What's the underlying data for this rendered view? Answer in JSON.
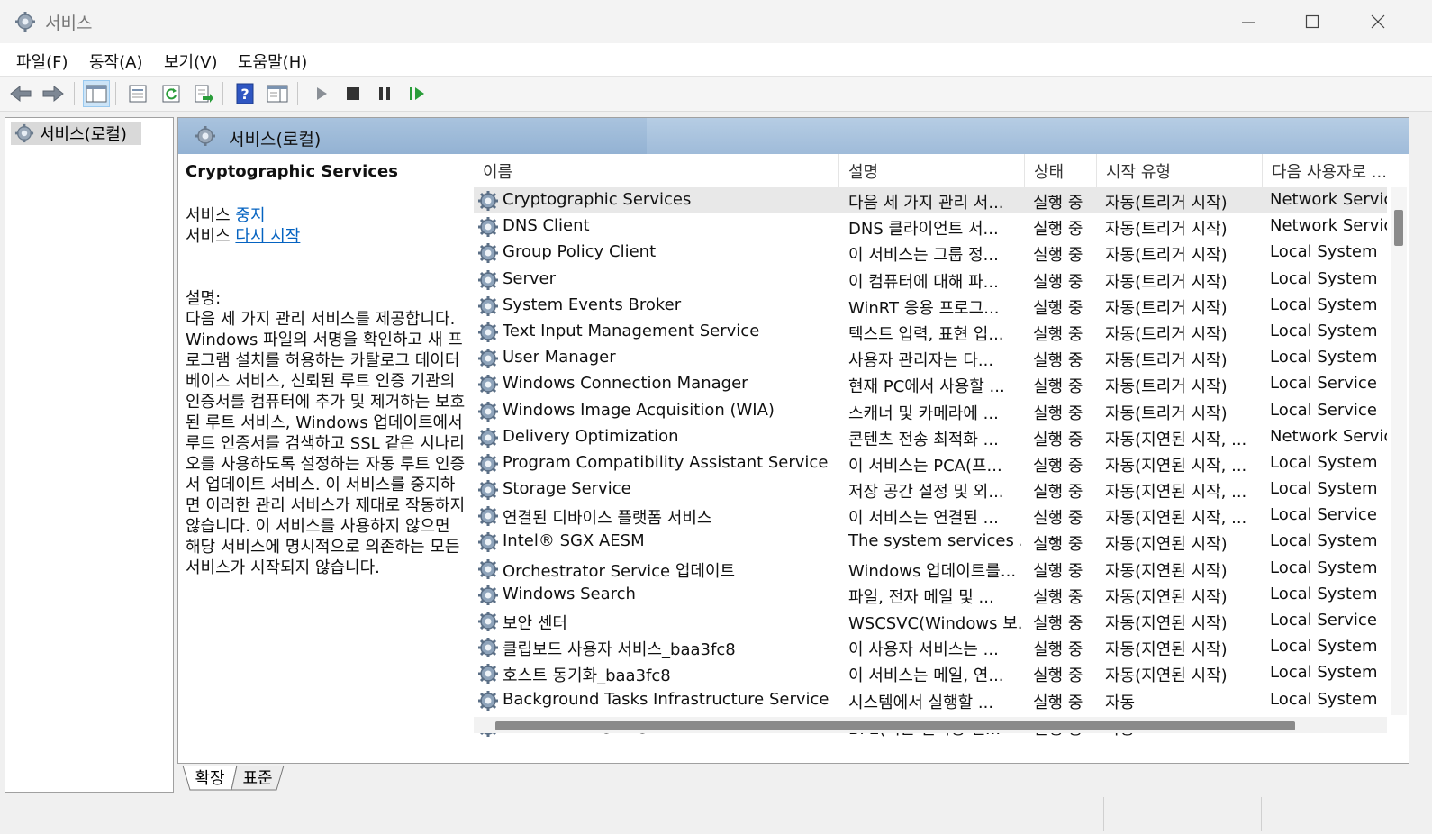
{
  "window": {
    "title": "서비스"
  },
  "menu": [
    {
      "label": "파일(F)"
    },
    {
      "label": "동작(A)"
    },
    {
      "label": "보기(V)"
    },
    {
      "label": "도움말(H)"
    }
  ],
  "tree": {
    "root": "서비스(로컬)"
  },
  "main": {
    "header": "서비스(로컬)",
    "selected_service": "Cryptographic Services",
    "action1_prefix": "서비스 ",
    "action1_link": "중지",
    "action2_prefix": "서비스 ",
    "action2_link": "다시 시작",
    "desc_label": "설명:",
    "description": "다음 세 가지 관리 서비스를 제공합니다. Windows 파일의 서명을 확인하고 새 프로그램 설치를 허용하는 카탈로그 데이터베이스 서비스, 신뢰된 루트 인증 기관의 인증서를 컴퓨터에 추가 및 제거하는 보호된 루트 서비스, Windows 업데이트에서 루트 인증서를 검색하고 SSL 같은 시나리오를 사용하도록 설정하는 자동 루트 인증서 업데이트 서비스. 이 서비스를 중지하면 이러한 관리 서비스가 제대로 작동하지 않습니다. 이 서비스를 사용하지 않으면 해당 서비스에 명시적으로 의존하는 모든 서비스가 시작되지 않습니다."
  },
  "columns": [
    "이름",
    "설명",
    "상태",
    "시작 유형",
    "다음 사용자로 ..."
  ],
  "services": [
    {
      "name": "Cryptographic Services",
      "desc": "다음 세 가지 관리 서...",
      "status": "실행 중",
      "startup": "자동(트리거 시작)",
      "logon": "Network Service"
    },
    {
      "name": "DNS Client",
      "desc": "DNS 클라이언트 서...",
      "status": "실행 중",
      "startup": "자동(트리거 시작)",
      "logon": "Network Service"
    },
    {
      "name": "Group Policy Client",
      "desc": "이 서비스는 그룹 정...",
      "status": "실행 중",
      "startup": "자동(트리거 시작)",
      "logon": "Local System"
    },
    {
      "name": "Server",
      "desc": "이 컴퓨터에 대해 파...",
      "status": "실행 중",
      "startup": "자동(트리거 시작)",
      "logon": "Local System"
    },
    {
      "name": "System Events Broker",
      "desc": "WinRT 응용 프로그...",
      "status": "실행 중",
      "startup": "자동(트리거 시작)",
      "logon": "Local System"
    },
    {
      "name": "Text Input Management Service",
      "desc": "텍스트 입력, 표현 입...",
      "status": "실행 중",
      "startup": "자동(트리거 시작)",
      "logon": "Local System"
    },
    {
      "name": "User Manager",
      "desc": "사용자 관리자는 다...",
      "status": "실행 중",
      "startup": "자동(트리거 시작)",
      "logon": "Local System"
    },
    {
      "name": "Windows Connection Manager",
      "desc": "현재 PC에서 사용할 ...",
      "status": "실행 중",
      "startup": "자동(트리거 시작)",
      "logon": "Local Service"
    },
    {
      "name": "Windows Image Acquisition (WIA)",
      "desc": "스캐너 및 카메라에 ...",
      "status": "실행 중",
      "startup": "자동(트리거 시작)",
      "logon": "Local Service"
    },
    {
      "name": "Delivery Optimization",
      "desc": "콘텐츠 전송 최적화 ...",
      "status": "실행 중",
      "startup": "자동(지연된 시작, ...",
      "logon": "Network Service"
    },
    {
      "name": "Program Compatibility Assistant Service",
      "desc": "이 서비스는 PCA(프...",
      "status": "실행 중",
      "startup": "자동(지연된 시작, ...",
      "logon": "Local System"
    },
    {
      "name": "Storage Service",
      "desc": "저장 공간 설정 및 외...",
      "status": "실행 중",
      "startup": "자동(지연된 시작, ...",
      "logon": "Local System"
    },
    {
      "name": "연결된 디바이스 플랫폼 서비스",
      "desc": "이 서비스는 연결된 ...",
      "status": "실행 중",
      "startup": "자동(지연된 시작, ...",
      "logon": "Local Service"
    },
    {
      "name": "Intel® SGX AESM",
      "desc": "The system services ...",
      "status": "실행 중",
      "startup": "자동(지연된 시작)",
      "logon": "Local System"
    },
    {
      "name": "Orchestrator Service 업데이트",
      "desc": "Windows 업데이트를...",
      "status": "실행 중",
      "startup": "자동(지연된 시작)",
      "logon": "Local System"
    },
    {
      "name": "Windows Search",
      "desc": "파일, 전자 메일 및 ...",
      "status": "실행 중",
      "startup": "자동(지연된 시작)",
      "logon": "Local System"
    },
    {
      "name": "보안 센터",
      "desc": "WSCSVC(Windows 보...",
      "status": "실행 중",
      "startup": "자동(지연된 시작)",
      "logon": "Local Service"
    },
    {
      "name": "클립보드 사용자 서비스_baa3fc8",
      "desc": "이 사용자 서비스는 ...",
      "status": "실행 중",
      "startup": "자동(지연된 시작)",
      "logon": "Local System"
    },
    {
      "name": "호스트 동기화_baa3fc8",
      "desc": "이 서비스는 메일, 연...",
      "status": "실행 중",
      "startup": "자동(지연된 시작)",
      "logon": "Local System"
    },
    {
      "name": "Background Tasks Infrastructure Service",
      "desc": "시스템에서 실행할 ...",
      "status": "실행 중",
      "startup": "자동",
      "logon": "Local System"
    },
    {
      "name": "Base Filtering Engine",
      "desc": "BFE(기본 필터링 엔...",
      "status": "실행 중",
      "startup": "자동",
      "logon": "Local Service"
    }
  ],
  "tabs": [
    {
      "label": "확장"
    },
    {
      "label": "표준"
    }
  ]
}
